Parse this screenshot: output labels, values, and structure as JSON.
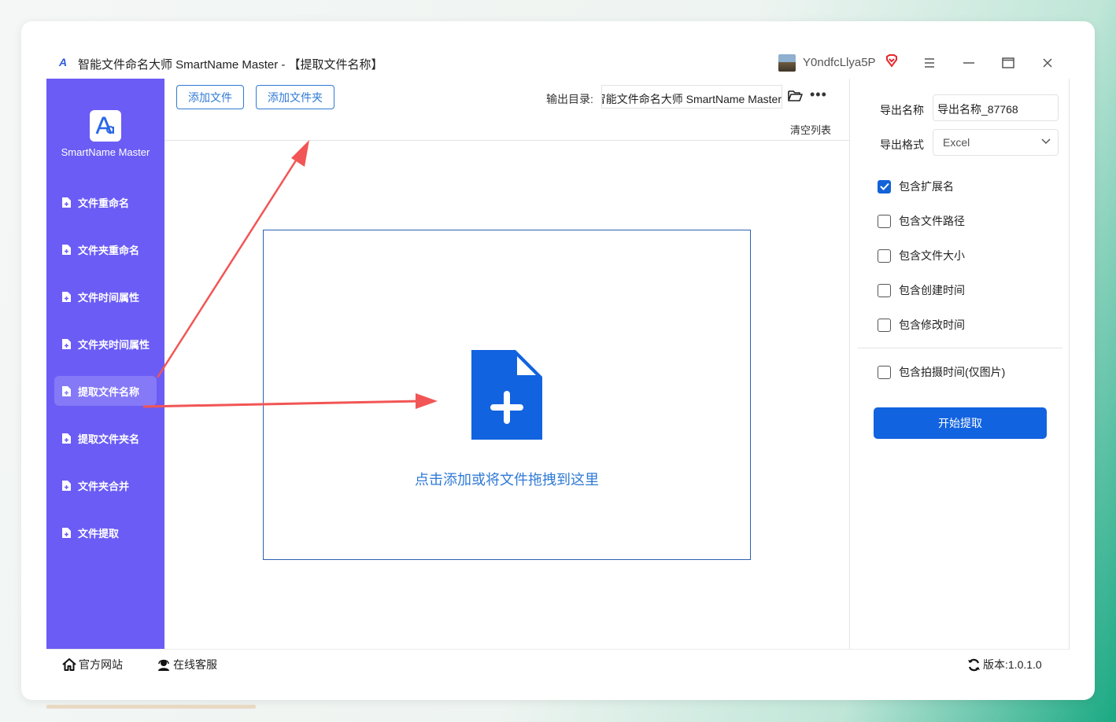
{
  "window": {
    "logo_glyph": "A",
    "title": "智能文件命名大师 SmartName Master - 【提取文件名称】",
    "username": "Y0ndfcLlya5P",
    "controls": [
      "menu-icon",
      "minimize-icon",
      "maximize-icon",
      "close-icon"
    ]
  },
  "sidebar": {
    "brand": "SmartName Master",
    "items": [
      {
        "label": "文件重命名",
        "active": false
      },
      {
        "label": "文件夹重命名",
        "active": false
      },
      {
        "label": "文件时间属性",
        "active": false
      },
      {
        "label": "文件夹时间属性",
        "active": false
      },
      {
        "label": "提取文件名称",
        "active": true
      },
      {
        "label": "提取文件夹名",
        "active": false
      },
      {
        "label": "文件夹合并",
        "active": false
      },
      {
        "label": "文件提取",
        "active": false
      }
    ]
  },
  "toolbar": {
    "add_file": "添加文件",
    "add_folder": "添加文件夹",
    "output_label": "输出目录:",
    "output_path": "智能文件命名大师 SmartName Master",
    "clear_list": "清空列表"
  },
  "dropzone": {
    "hint": "点击添加或将文件拖拽到这里"
  },
  "options": {
    "export_name_label": "导出名称",
    "export_name_value": "导出名称_87768",
    "export_format_label": "导出格式",
    "export_format_value": "Excel",
    "checkboxes": [
      {
        "label": "包含扩展名",
        "checked": true
      },
      {
        "label": "包含文件路径",
        "checked": false
      },
      {
        "label": "包含文件大小",
        "checked": false
      },
      {
        "label": "包含创建时间",
        "checked": false
      },
      {
        "label": "包含修改时间",
        "checked": false
      },
      {
        "label": "包含拍摄时间(仅图片)",
        "checked": false
      }
    ],
    "start_button": "开始提取"
  },
  "footer": {
    "website": "官方网站",
    "support": "在线客服",
    "version": "版本:1.0.1.0"
  },
  "colors": {
    "sidebar": "#6b5cf5",
    "accent": "#1263e0",
    "annotation_arrow": "#f25555"
  }
}
